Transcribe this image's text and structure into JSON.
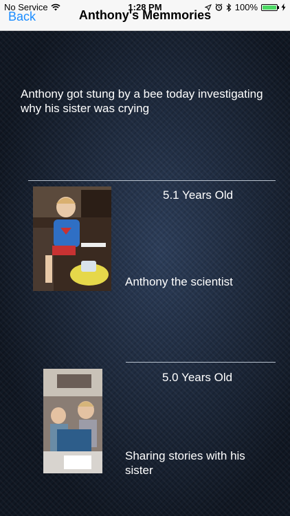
{
  "status_bar": {
    "carrier": "No Service",
    "time": "1:28 PM",
    "battery_percent": "100%",
    "battery_level": 1.0,
    "icons": [
      "wifi-icon",
      "location-arrow-icon",
      "alarm-icon",
      "bluetooth-icon",
      "battery-icon",
      "charging-bolt-icon"
    ]
  },
  "nav": {
    "back_label": "Back",
    "title": "Anthony's Memmories"
  },
  "memory": {
    "text": "Anthony got stung by a bee today investigating why his sister was crying"
  },
  "entries": [
    {
      "age": "5.1 Years Old",
      "caption": "Anthony the scientist"
    },
    {
      "age": "5.0 Years Old",
      "caption": "Sharing stories with his sister"
    }
  ],
  "colors": {
    "accent": "#1a8cff",
    "background": "#1e2b40",
    "battery": "#4cd964"
  }
}
